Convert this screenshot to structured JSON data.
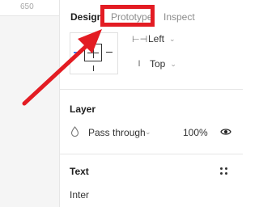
{
  "ruler": {
    "label": "650"
  },
  "tabs": [
    {
      "label": "Design",
      "active": true
    },
    {
      "label": "Prototype",
      "active": false
    },
    {
      "label": "Inspect",
      "active": false
    }
  ],
  "constraints": {
    "horizontal": {
      "icon": "horizontal-constraint-icon",
      "value": "Left"
    },
    "vertical": {
      "icon": "vertical-constraint-icon",
      "value": "Top"
    }
  },
  "layer": {
    "title": "Layer",
    "blend_mode": "Pass through",
    "opacity": "100%",
    "icons": [
      "blend-drop-icon",
      "eye-icon"
    ]
  },
  "text_section": {
    "title": "Text",
    "font": "Inter",
    "icon": "text-styles-grid-icon"
  },
  "colors": {
    "highlight": "#e31c23",
    "constraint_accent": "#3b82f6"
  }
}
